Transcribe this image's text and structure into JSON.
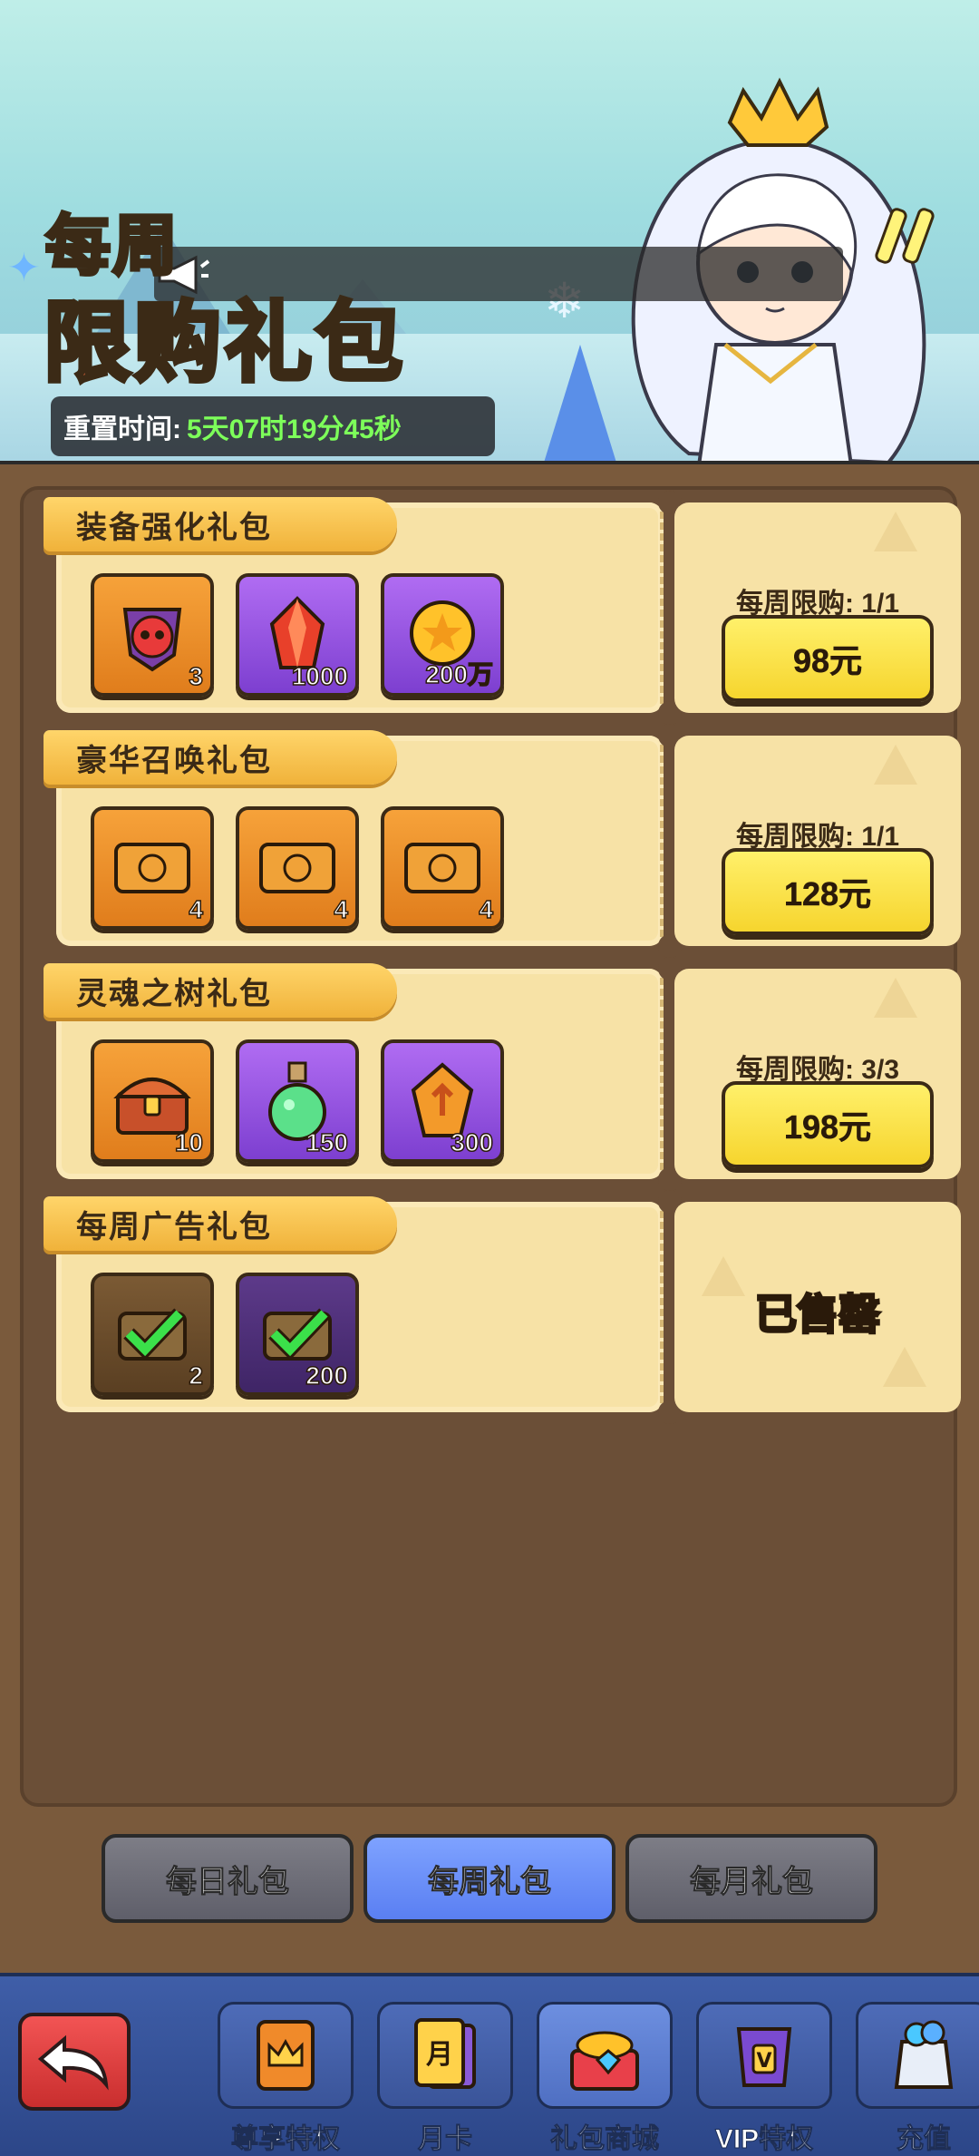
{
  "banner": {
    "title_line1": "每周",
    "title_line2_a": "限购",
    "title_line2_b": "礼包",
    "reset_label": "重置时间:",
    "reset_time": "5天07时19分45秒"
  },
  "packs": [
    {
      "name": "装备强化礼包",
      "items": [
        {
          "icon": "demon-armor-icon",
          "qty": "3"
        },
        {
          "icon": "red-crystal-icon",
          "qty": "1000"
        },
        {
          "icon": "gold-coin-icon",
          "qty": "200万"
        }
      ],
      "limit": "每周限购: 1/1",
      "price": "98元"
    },
    {
      "name": "豪华召唤礼包",
      "items": [
        {
          "icon": "summon-ticket-icon",
          "qty": "4"
        },
        {
          "icon": "summon-ticket-icon",
          "qty": "4"
        },
        {
          "icon": "summon-ticket-icon",
          "qty": "4"
        }
      ],
      "limit": "每周限购: 1/1",
      "price": "128元"
    },
    {
      "name": "灵魂之树礼包",
      "items": [
        {
          "icon": "treasure-chest-icon",
          "qty": "10"
        },
        {
          "icon": "green-potion-icon",
          "qty": "150"
        },
        {
          "icon": "amber-crystal-icon",
          "qty": "300"
        }
      ],
      "limit": "每周限购: 3/3",
      "price": "198元"
    },
    {
      "name": "每周广告礼包",
      "items": [
        {
          "icon": "check-ticket-icon",
          "qty": "2"
        },
        {
          "icon": "check-ticket-icon",
          "qty": "200"
        }
      ],
      "status": "已售罄"
    }
  ],
  "tabs": [
    "每日礼包",
    "每周礼包",
    "每月礼包"
  ],
  "active_tab": "每周礼包",
  "bottom_nav": [
    {
      "label": "尊享特权",
      "icon": "crown-card-icon"
    },
    {
      "label": "月卡",
      "icon": "month-card-icon",
      "badge": "月"
    },
    {
      "label": "礼包商城",
      "icon": "gift-shop-icon"
    },
    {
      "label": "VIP特权",
      "icon": "vip-chest-icon",
      "badge": "V"
    },
    {
      "label": "充值",
      "icon": "gem-bag-icon"
    }
  ],
  "active_nav": "礼包商城",
  "colors": {
    "panel": "#6b4f37",
    "card": "#f7e2a6",
    "price_button": "#f6d52e",
    "active_tab": "#5a7ff2",
    "nav_bar": "#3f5ea8",
    "countdown": "#7dff5a"
  }
}
